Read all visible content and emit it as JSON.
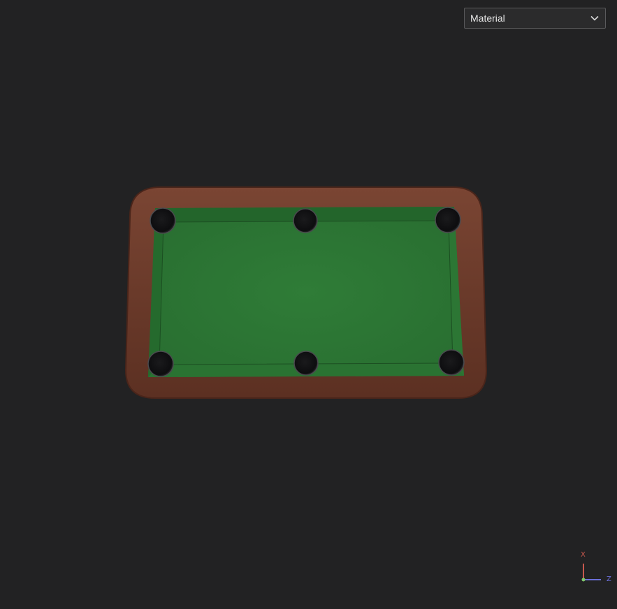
{
  "shading_mode": {
    "selected": "Material",
    "icon": "chevron-down-icon"
  },
  "model": {
    "name": "pool-table",
    "pockets": 6,
    "colors": {
      "frame": "#6a3a2a",
      "frame_edge": "#4a251a",
      "felt": "#2e7a36",
      "felt_dark": "#22602a",
      "pocket": "#111113"
    }
  },
  "axes": {
    "x_label": "X",
    "z_label": "Z",
    "colors": {
      "x": "#c8584e",
      "z": "#6b6fd8",
      "y": "#7ec46a"
    }
  },
  "colors": {
    "background": "#222223"
  }
}
